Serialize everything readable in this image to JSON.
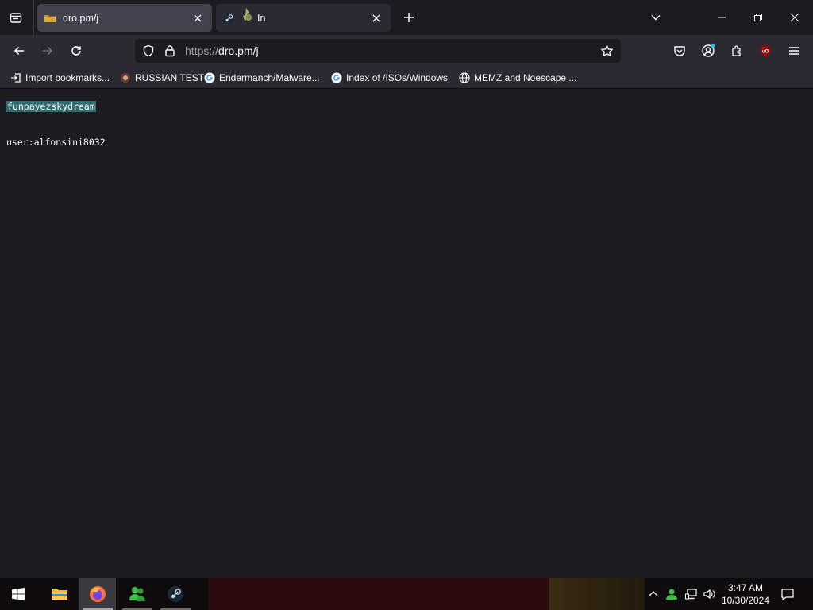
{
  "tabs": [
    {
      "title": "dro.pm/j",
      "active": true
    },
    {
      "title": "In",
      "active": false
    }
  ],
  "url": {
    "scheme": "https://",
    "rest": "dro.pm/j"
  },
  "bookmarks": [
    {
      "label": "Import bookmarks...",
      "icon": "import-icon"
    },
    {
      "label": "RUSSIAN TEST",
      "icon": "site-icon"
    },
    {
      "label": "Endermanch/Malware...",
      "icon": "google-icon"
    },
    {
      "label": "Index of /ISOs/Windows",
      "icon": "google-icon"
    },
    {
      "label": "MEMZ and Noescape ...",
      "icon": "globe-icon"
    }
  ],
  "page": {
    "line1": "funpayezskydream",
    "line2": "user:alfonsini8032"
  },
  "taskbar": {
    "time": "3:47 AM",
    "date": "10/30/2024"
  },
  "colors": {
    "tab_active": "#42414d",
    "toolbar": "#2b2a33",
    "page_bg": "#1c1b22",
    "selection": "#2e6e73",
    "ublock": "#8b0a0a"
  }
}
